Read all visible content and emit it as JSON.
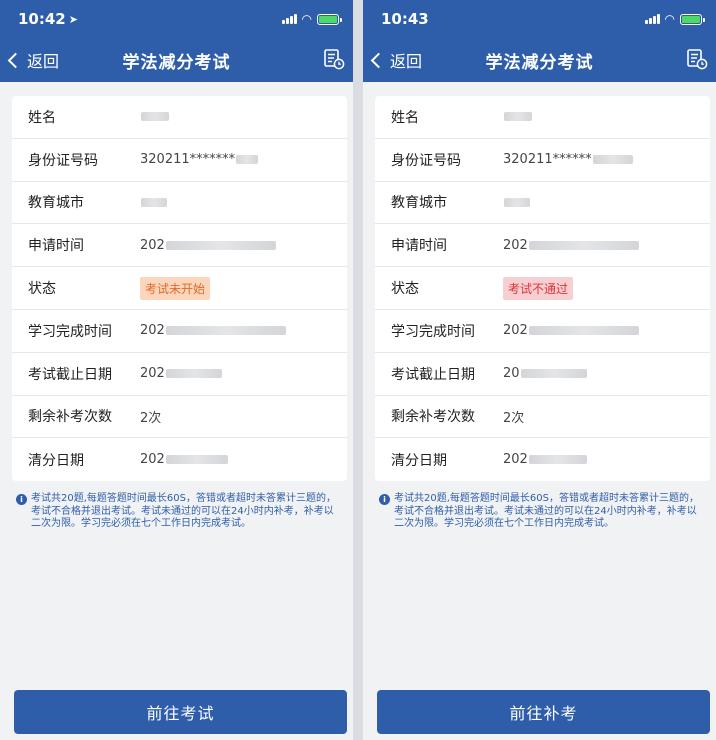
{
  "screens": [
    {
      "status_time": "10:42",
      "back_label": "返回",
      "title": "学法减分考试",
      "rows": [
        {
          "label": "姓名",
          "value": "",
          "mask_width": 28
        },
        {
          "label": "身份证号码",
          "value": "320211*******",
          "mask_width": 22
        },
        {
          "label": "教育城市",
          "value": "",
          "mask_width": 26
        },
        {
          "label": "申请时间",
          "value": "202",
          "mask_width": 110
        },
        {
          "label": "状态",
          "badge": "考试未开始",
          "badge_color": "#e0692a"
        },
        {
          "label": "学习完成时间",
          "value": "202",
          "mask_width": 120
        },
        {
          "label": "考试截止日期",
          "value": "202",
          "mask_width": 56
        },
        {
          "label": "剩余补考次数",
          "value": "2次",
          "mask_width": 0
        },
        {
          "label": "清分日期",
          "value": "202",
          "mask_width": 62
        }
      ],
      "notice": "考试共20题,每题答题时间最长60S，答错或者超时未答累计三题的，考试不合格并退出考试。考试未通过的可以在24小时内补考，补考以二次为限。学习完必须在七个工作日内完成考试。",
      "button_label": "前往考试"
    },
    {
      "status_time": "10:43",
      "back_label": "返回",
      "title": "学法减分考试",
      "rows": [
        {
          "label": "姓名",
          "value": "",
          "mask_width": 28
        },
        {
          "label": "身份证号码",
          "value": "320211******",
          "mask_width": 40
        },
        {
          "label": "教育城市",
          "value": "",
          "mask_width": 26
        },
        {
          "label": "申请时间",
          "value": "202",
          "mask_width": 110
        },
        {
          "label": "状态",
          "badge": "考试不通过",
          "badge_color": "#d8343b"
        },
        {
          "label": "学习完成时间",
          "value": "202",
          "mask_width": 110
        },
        {
          "label": "考试截止日期",
          "value": "20",
          "mask_width": 66
        },
        {
          "label": "剩余补考次数",
          "value": "2次",
          "mask_width": 0
        },
        {
          "label": "清分日期",
          "value": "202",
          "mask_width": 58
        }
      ],
      "notice": "考试共20题,每题答题时间最长60S，答错或者超时未答累计三题的，考试不合格并退出考试。考试未通过的可以在24小时内补考，补考以二次为限。学习完必须在七个工作日内完成考试。",
      "button_label": "前往补考"
    }
  ],
  "colors": {
    "brand": "#2e5ea9",
    "background": "#f1f2f4"
  },
  "icons": {
    "back": "chevron-left-icon",
    "records": "document-clock-icon",
    "info": "info-icon"
  }
}
